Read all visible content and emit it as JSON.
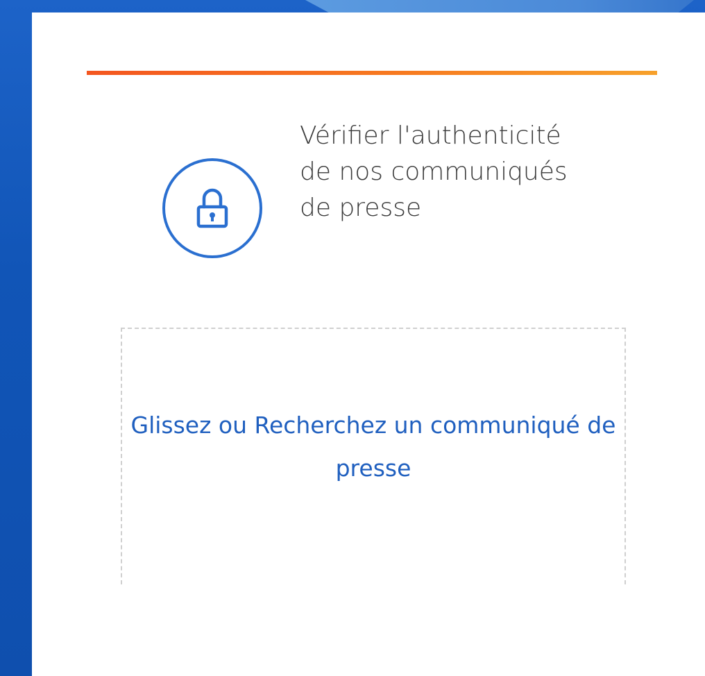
{
  "verify": {
    "heading": "Vérifier l'authenticité de nos communiqués de presse",
    "icon": "lock-icon"
  },
  "drop_zone": {
    "label": "Glissez ou Recherchez un communiqué de presse"
  },
  "colors": {
    "background_blue": "#1156b8",
    "accent_orange": "#f4561f",
    "icon_blue": "#2a6fd0",
    "link_blue": "#1f5fbf",
    "text_gray": "#3a3a3a",
    "dash_gray": "#cfcfcf"
  }
}
